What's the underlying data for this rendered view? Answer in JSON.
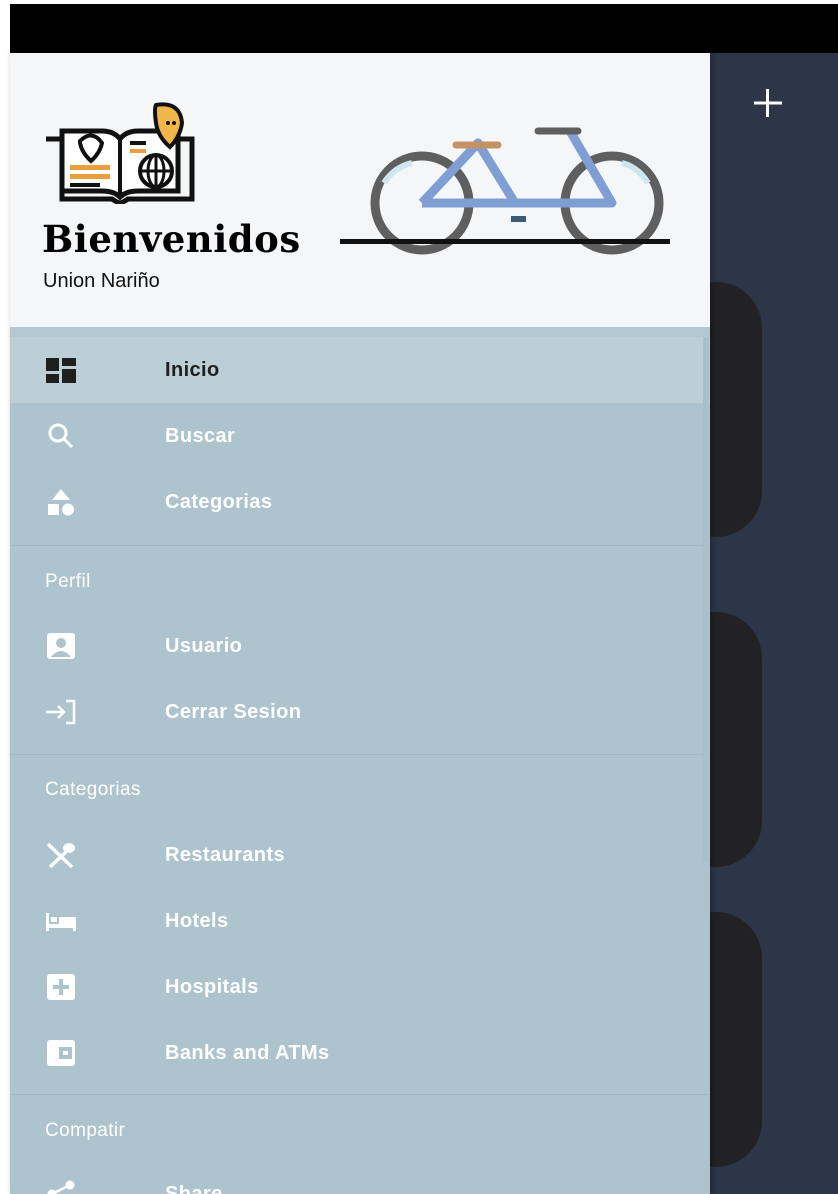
{
  "header": {
    "title": "Bienvenidos",
    "subtitle": "Union Nariño"
  },
  "menu": {
    "main": [
      {
        "label": "Inicio",
        "icon": "dashboard-icon",
        "active": true
      },
      {
        "label": "Buscar",
        "icon": "search-icon"
      },
      {
        "label": "Categorias",
        "icon": "category-shapes-icon"
      }
    ],
    "sections": [
      {
        "title": "Perfil",
        "items": [
          {
            "label": "Usuario",
            "icon": "account-box-icon"
          },
          {
            "label": "Cerrar Sesion",
            "icon": "login-icon"
          }
        ]
      },
      {
        "title": "Categorias",
        "items": [
          {
            "label": "Restaurants",
            "icon": "restaurant-icon"
          },
          {
            "label": "Hotels",
            "icon": "hotel-bed-icon"
          },
          {
            "label": "Hospitals",
            "icon": "hospital-icon"
          },
          {
            "label": "Banks and ATMs",
            "icon": "wallet-icon"
          }
        ]
      },
      {
        "title": "Compatir",
        "items": [
          {
            "label": "Share",
            "icon": "share-icon"
          }
        ]
      }
    ]
  },
  "toolbar": {
    "add_icon": "plus-icon"
  },
  "colors": {
    "drawer_bg": "#adc4cf",
    "active_item_bg": "#bccfd7",
    "header_bg": "#f5f6f8",
    "app_bg": "#2d3549",
    "card_bg": "#222224"
  }
}
